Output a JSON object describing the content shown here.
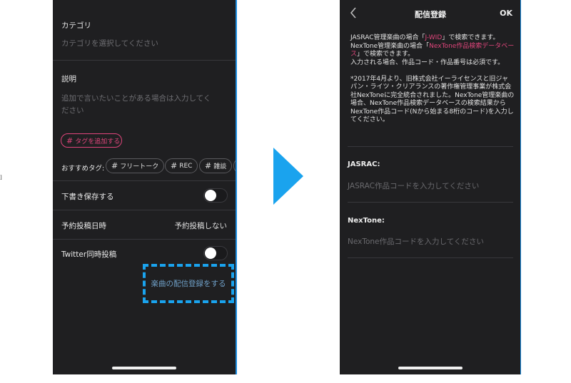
{
  "left_screen": {
    "category": {
      "label": "カテゴリ",
      "placeholder": "カテゴリを選択してください"
    },
    "description": {
      "label": "説明",
      "placeholder_line1": "追加で言いたいことがある場合は入力してく",
      "placeholder_line2": "ださい"
    },
    "tag_add": {
      "hash": "#",
      "label": "タグを追加する"
    },
    "recommended": {
      "label": "おすすめタグ:",
      "tags": [
        {
          "hash": "#",
          "label": "フリートーク"
        },
        {
          "hash": "#",
          "label": "REC"
        },
        {
          "hash": "#",
          "label": "雑談"
        }
      ]
    },
    "draft": {
      "label": "下書き保存する",
      "on": false
    },
    "schedule": {
      "label": "予約投稿日時",
      "value": "予約投稿しない"
    },
    "twitter": {
      "label": "Twitter同時投稿",
      "on": false
    },
    "music_link": "楽曲の配信登録をする"
  },
  "right_screen": {
    "nav": {
      "title": "配信登録",
      "ok": "OK"
    },
    "notice": {
      "line1_a": "JASRAC管理楽曲の場合「",
      "line1_link": "J-WID",
      "line1_b": "」で検索できます。",
      "line2_a": "NexTone管理楽曲の場合「",
      "line2_link": "NexTone作品検索データベース",
      "line2_b": "」で検索できます。",
      "line3": "入力される場合、作品コード・作品番号は必須です。",
      "para2": "*2017年4月より、旧株式会社イーライセンスと旧ジャパン・ライツ・クリアランスの著作権管理事業が株式会社NexToneに完全統合されました。NexTone管理楽曲の場合、NexTone作品検索データベースの検索結果から",
      "para3": "NexTone作品コード(Nから始まる8桁のコード)を入力してください。"
    },
    "jasrac": {
      "label": "JASRAC:",
      "placeholder": "JASRAC作品コードを入力してください"
    },
    "nextone": {
      "label": "NexTone:",
      "placeholder": "NexTone作品コードを入力してください"
    }
  },
  "colors": {
    "accent_blue": "#1aa3ee",
    "pink": "#e0457b",
    "background": "#1f1f21"
  },
  "stray_mark": "]"
}
